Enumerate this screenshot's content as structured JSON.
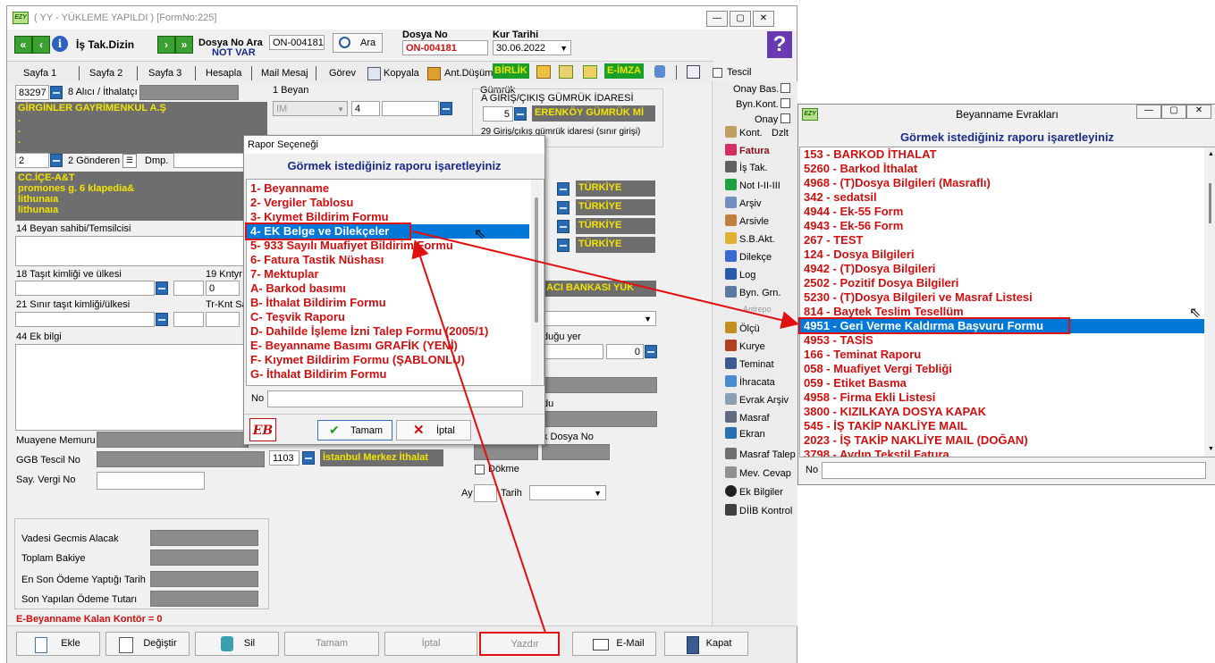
{
  "main_window": {
    "title": "( YY  - YÜKLEME YAPILDI ) [FormNo:225]",
    "toolbar": {
      "is_tak_dizin": "İş Tak.Dizin",
      "dosya_no_ara": "Dosya No Ara",
      "dosya_no_ara_value": "ON-004181",
      "ara_button": "Ara",
      "not_var": "NOT VAR",
      "dosya_no_label": "Dosya No",
      "dosya_no_value": "ON-004181",
      "kur_tarihi_label": "Kur Tarihi",
      "kur_tarihi_value": "30.06.2022"
    },
    "tabs": [
      "Sayfa 1",
      "Sayfa 2",
      "Sayfa 3",
      "Hesapla",
      "Mail Mesaj",
      "Görev",
      "Kopyala",
      "Ant.Düşüm",
      "BİRLİK",
      "E-İMZA",
      "Tescil"
    ],
    "form": {
      "alici_code": "83297",
      "alici_label": "8 Alıcı / İthalatçı",
      "alici_name": "GİRGİNLER GAYRİMENKUL A.Ş",
      "alici_dots": [
        ".",
        ".",
        "."
      ],
      "beyan_label": "1 Beyan",
      "beyan_type": "IM",
      "beyan_num": "4",
      "gumruk_label": "Gümrük",
      "giris_cikis_label": "A GİRİŞ/ÇIKIŞ GÜMRÜK İDARESİ",
      "gumruk_code": "5",
      "gumruk_name": "ERENKÖY GÜMRÜK Mİ",
      "giris_cikis_sinir": "29 Giriş/çıkış gümrük idaresi (sınır girişi)",
      "gonderen_code": "2",
      "gonderen_label": "2 Gönderen",
      "dmp_label": "Dmp.",
      "gonderen_lines": [
        "CC.İÇE-A&T",
        "promones g. 6 klapedia&",
        "lithunaıa",
        "lithunaıa"
      ],
      "ulke_values": [
        "TÜRKİYE",
        "TÜRKİYE",
        "TÜRKİYE",
        "TÜRKİYE"
      ],
      "beyan_sahibi_label": "14 Beyan sahibi/Temsilcisi",
      "tasit_label": "18 Taşıt kimliği ve ülkesi",
      "kntyr_label": "19 Kntyr",
      "kntyr_value": "0",
      "sinir_tasit_label": "21 Sınır taşıt kimliği/ülkesi",
      "tr_knt_label": "Tr-Knt Sa",
      "banka_value": "ACI BANKASI YUK",
      "ek_bilgi_label": "44 Ek bilgi",
      "dugu_yer_label": "duğu yer",
      "dugu_yer_num": "0",
      "du_label": "du",
      "k_dosya_no_label": "k Dosya No",
      "muayene_label": "Muayene Memuru",
      "ggb_label": "GGB Tescil No",
      "say_vergi_label": "Say. Vergi No",
      "ggb_code": "1103",
      "ggb_name": "İstanbul Merkez İthalat",
      "dokme_label": "Dökme",
      "ay_label": "Ay",
      "tarih_label": "Tarih",
      "vadesi_label": "Vadesi Gecmis Alacak",
      "toplam_bakiye_label": "Toplam Bakiye",
      "en_son_odeme_label": "En Son Ödeme Yaptığı Tarih",
      "son_odeme_tutar_label": "Son Yapılan Ödeme Tutarı",
      "kontor_text": "E-Beyanname Kalan Kontör = 0"
    },
    "side_checks": [
      "Onay Bas.",
      "Byn.Kont.",
      "Onay"
    ],
    "side_items": [
      "Kont.",
      "Dzlt",
      "Fatura",
      "İş Tak.",
      "Not I-II-III",
      "Arşiv",
      "Arsivle",
      "S.B.Akt.",
      "Dilekçe",
      "Log",
      "Byn. Grn.",
      "Antrepo",
      "Ölçü",
      "Kurye",
      "Teminat",
      "İhracata",
      "Evrak Arşiv",
      "Masraf",
      "Ekran",
      "Masraf Talep",
      "Mev. Cevap",
      "Ek Bilgiler",
      "DİİB Kontrol"
    ],
    "bottom_buttons": [
      "Ekle",
      "Değiştir",
      "Sil",
      "Tamam",
      "İptal",
      "Yazdır",
      "E-Mail",
      "Kapat"
    ]
  },
  "rapor_dialog": {
    "title": "Rapor Seçeneği",
    "header": "Görmek istediğiniz raporu işaretleyiniz",
    "items": [
      "1- Beyanname",
      "2- Vergiler Tablosu",
      "3- Kıymet Bildirim Formu",
      "4- EK Belge ve Dilekçeler",
      "5- 933 Sayılı Muafiyet Bildirim Formu",
      "6- Fatura Tastik Nüshası",
      "7- Mektuplar",
      "A- Barkod basımı",
      "B- İthalat Bildirim Formu",
      "C- Teşvik Raporu",
      "D- Dahilde İşleme İzni Talep Formu (2005/1)",
      "E- Beyanname Basımı GRAFİK (YENİ)",
      "F- Kıymet Bildirim Formu (ŞABLONLU)",
      "G- İthalat Bildirim Formu"
    ],
    "selected_index": 3,
    "no_label": "No",
    "ok_button": "Tamam",
    "cancel_button": "İptal",
    "logo_text": "EB"
  },
  "evrak_window": {
    "title": "Beyanname Evrakları",
    "header": "Görmek istediğiniz raporu işaretleyiniz",
    "items": [
      "153 - BARKOD İTHALAT",
      "5260 - Barkod İthalat",
      "4968 - (T)Dosya Bilgileri (Masraflı)",
      "342 - sedatsil",
      "4944 - Ek-55 Form",
      "4943 - Ek-56 Form",
      "267 - TEST",
      "124 - Dosya Bilgileri",
      "4942 - (T)Dosya Bilgileri",
      "2502 - Pozitif Dosya Bilgileri",
      "5230 - (T)Dosya Bilgileri ve Masraf Listesi",
      "814 - Baytek Teslim Tesellüm",
      "4951 - Geri Verme Kaldırma Başvuru Formu",
      "4953 - TASİS",
      "166 - Teminat Raporu",
      "058 - Muafiyet Vergi Tebliği",
      "059 - Etiket Basma",
      "4958 - Firma Ekli Listesi",
      "3800 - KIZILKAYA DOSYA KAPAK",
      "545 - İŞ TAKİP NAKLİYE MAIL",
      "2023 - İŞ TAKİP NAKLİYE MAIL (DOĞAN)",
      "3798 - Aydın Tekstil Fatura"
    ],
    "selected_index": 12,
    "no_label": "No"
  },
  "colors": {
    "accent_red": "#e01010",
    "list_red": "#d01010",
    "selection_blue": "#0078d7",
    "header_blue": "#1a2a8a",
    "yellow_text": "#f2e400"
  }
}
